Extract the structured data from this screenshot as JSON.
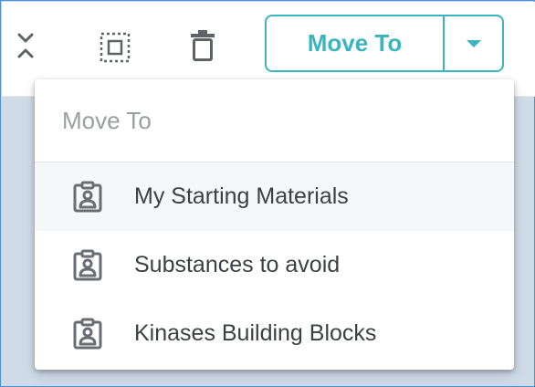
{
  "toolbar": {
    "icons": {
      "collapse": "collapse-icon",
      "select": "select-all-icon",
      "delete": "trash-icon"
    },
    "move_button": {
      "label": "Move To",
      "caret": "caret-down-icon",
      "accent_color": "#3ab5c0"
    }
  },
  "dropdown": {
    "header": "Move To",
    "items": [
      {
        "label": "My Starting Materials",
        "icon": "clipboard-user-icon",
        "highlighted": true
      },
      {
        "label": "Substances to avoid",
        "icon": "clipboard-user-icon",
        "highlighted": false
      },
      {
        "label": "Kinases Building Blocks",
        "icon": "clipboard-user-icon",
        "highlighted": false
      }
    ]
  }
}
